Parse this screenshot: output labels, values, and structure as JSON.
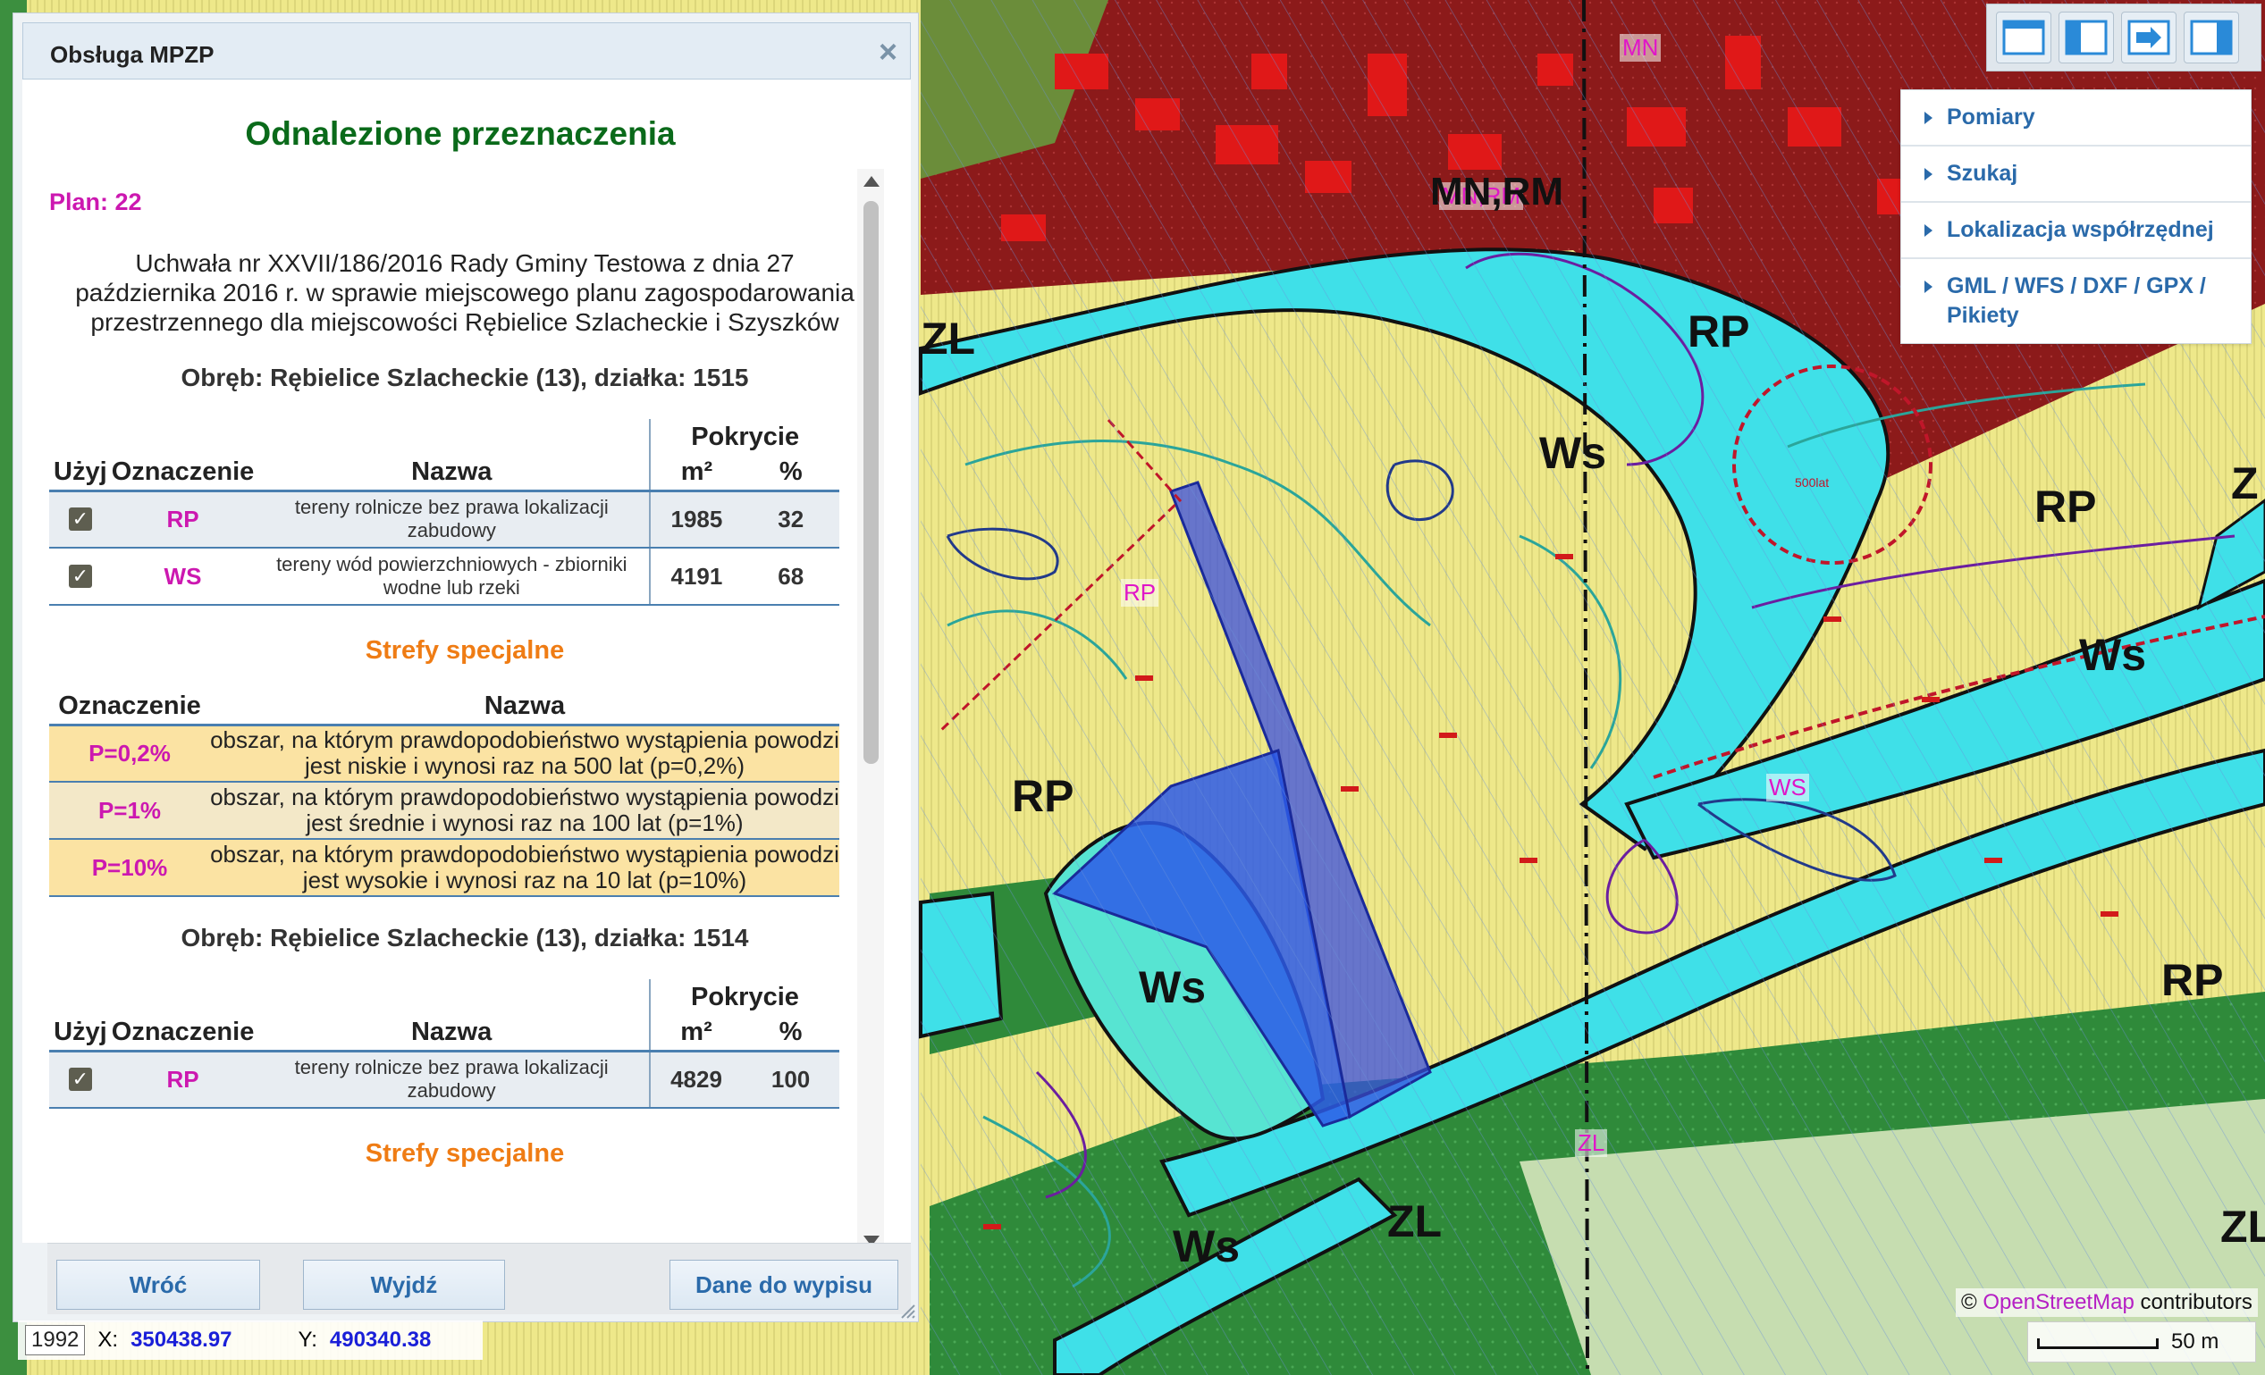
{
  "panel": {
    "title": "Obsługa MPZP",
    "close_symbol": "×",
    "heading": "Odnalezione przeznaczenia",
    "plan_label": "Plan: 22",
    "resolution": "Uchwała nr XXVII/186/2016 Rady Gminy Testowa z dnia 27 października 2016 r. w sprawie miejscowego planu zagospodarowania przestrzennego dla miejscowości Rębielice Szlacheckie i Szyszków",
    "table_headers": {
      "use": "Użyj",
      "code": "Oznaczenie",
      "name": "Nazwa",
      "coverage": "Pokrycie",
      "m2": "m²",
      "pct": "%"
    },
    "zones_headers": {
      "code": "Oznaczenie",
      "name": "Nazwa"
    },
    "parcels": [
      {
        "title": "Obręb: Rębielice Szlacheckie (13), działka: 1515",
        "rows": [
          {
            "code": "RP",
            "name": "tereny rolnicze bez prawa lokalizacji zabudowy",
            "m2": "1985",
            "pct": "32",
            "checked": true
          },
          {
            "code": "WS",
            "name": "tereny wód powierzchniowych - zbiorniki wodne lub rzeki",
            "m2": "4191",
            "pct": "68",
            "checked": true
          }
        ],
        "zones_title": "Strefy specjalne",
        "zones": [
          {
            "code": "P=0,2%",
            "name": "obszar, na którym prawdopodobieństwo wystąpienia powodzi jest niskie i wynosi raz na 500 lat (p=0,2%)",
            "color": "#fbe3a3"
          },
          {
            "code": "P=1%",
            "name": "obszar, na którym prawdopodobieństwo wystąpienia powodzi jest średnie i wynosi raz na 100 lat (p=1%)",
            "color": "#f3e8c8"
          },
          {
            "code": "P=10%",
            "name": "obszar, na którym prawdopodobieństwo wystąpienia powodzi jest wysokie i wynosi raz na 10 lat (p=10%)",
            "color": "#fbe3a3"
          }
        ]
      },
      {
        "title": "Obręb: Rębielice Szlacheckie (13), działka: 1514",
        "rows": [
          {
            "code": "RP",
            "name": "tereny rolnicze bez prawa lokalizacji zabudowy",
            "m2": "4829",
            "pct": "100",
            "checked": true
          }
        ],
        "zones_title": "Strefy specjalne"
      }
    ],
    "buttons": {
      "back": "Wróć",
      "exit": "Wyjdź",
      "extract": "Dane do wypisu"
    }
  },
  "map_tools": {
    "layout_buttons": [
      "layout-full-icon",
      "layout-left-panel-icon",
      "layout-arrow-right-icon",
      "layout-right-panel-icon"
    ],
    "menu": [
      "Pomiary",
      "Szukaj",
      "Lokalizacja współrzędnej",
      "GML / WFS / DXF / GPX / Pikiety"
    ]
  },
  "map_labels": {
    "mn": "MN",
    "mnrm_small": "MN,RM",
    "mnrm": "MN,RM",
    "rp": "RP",
    "ws": "Ws",
    "zl": "ZL",
    "z": "Z",
    "rp_small": "RP",
    "ws_small": "WS",
    "zl_small": "ZL",
    "flood_label": "500lat"
  },
  "attribution": {
    "prefix": "©",
    "link": "OpenStreetMap",
    "suffix": "contributors"
  },
  "scale": {
    "label": "50 m"
  },
  "coords": {
    "epsg": "1992",
    "x_label": "X:",
    "x_value": "350438.97",
    "y_label": "Y:",
    "y_value": "490340.38"
  },
  "colors": {
    "agricultural": "#eee88a",
    "water": "#3fe0e8",
    "forest": "#2f8a3a",
    "residential": "#8c1a1a",
    "parcel_highlight": "#3a4fe0",
    "heading_green": "#0a6a1a",
    "code_magenta": "#cc18b0",
    "zones_orange": "#ef7c14",
    "link_blue": "#2a6aaa"
  }
}
